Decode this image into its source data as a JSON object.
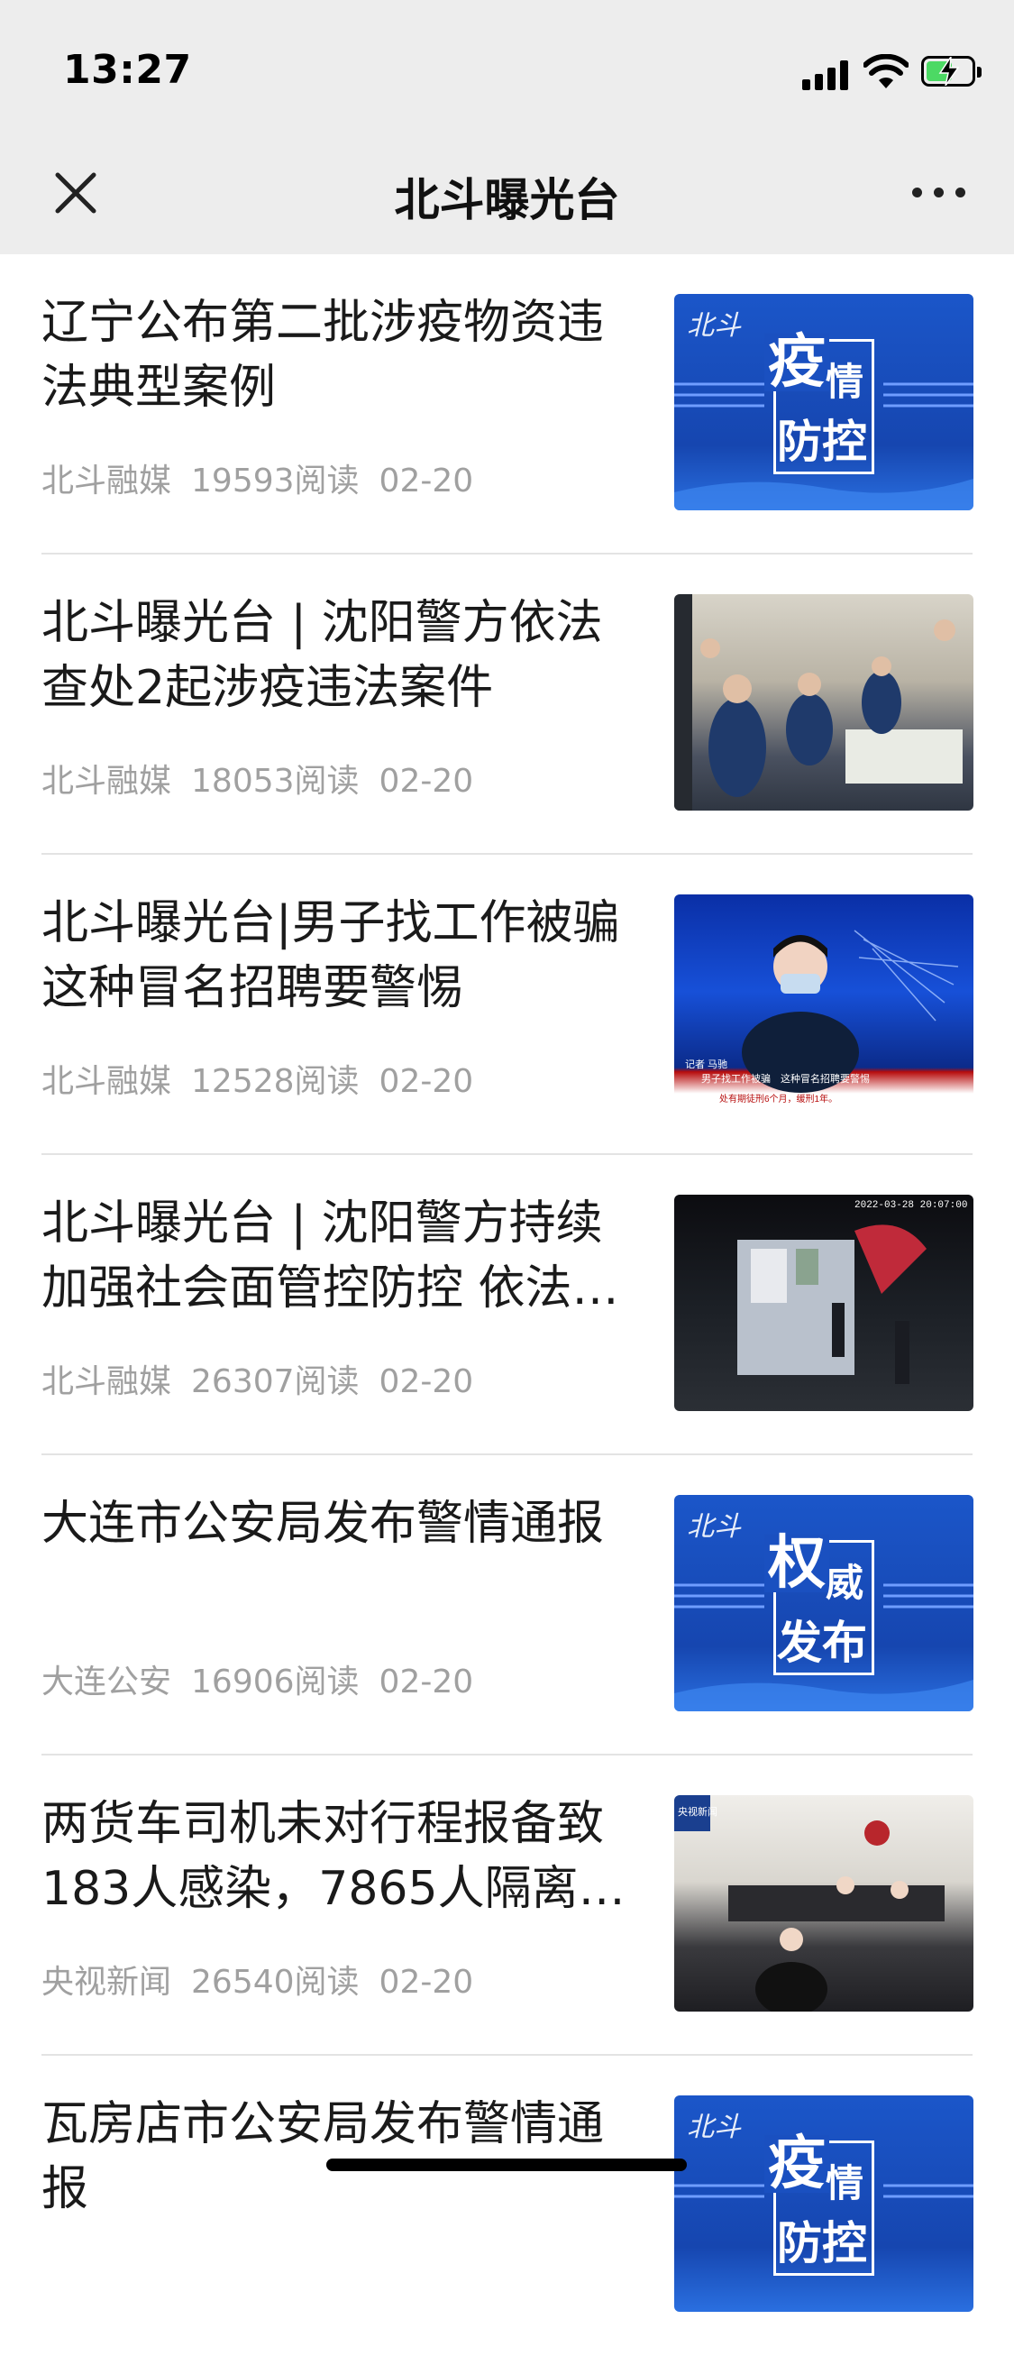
{
  "status_bar": {
    "time": "13:27"
  },
  "nav": {
    "title": "北斗曝光台"
  },
  "articles": [
    {
      "title": "辽宁公布第二批涉疫物资违法典型案例",
      "source": "北斗融媒",
      "reads": "19593阅读",
      "date": "02-20",
      "thumb": {
        "type": "brand-card",
        "brand": "北斗",
        "big": "疫",
        "small": "情",
        "row2": "防控"
      }
    },
    {
      "title": "北斗曝光台 | 沈阳警方依法查处2起涉疫违法案件",
      "source": "北斗融媒",
      "reads": "18053阅读",
      "date": "02-20",
      "thumb": {
        "type": "photo",
        "desc": "room"
      }
    },
    {
      "title": "北斗曝光台|男子找工作被骗这种冒名招聘要警惕",
      "source": "北斗融媒",
      "reads": "12528阅读",
      "date": "02-20",
      "thumb": {
        "type": "photo",
        "desc": "news",
        "caption1": "记者 马驰",
        "caption2": "男子找工作被骗　这种冒名招聘要警惕",
        "caption3": "处有期徒刑6个月，缓刑1年。"
      }
    },
    {
      "title": "北斗曝光台 | 沈阳警方持续加强社会面管控防控 依法查…",
      "source": "北斗融媒",
      "reads": "26307阅读",
      "date": "02-20",
      "thumb": {
        "type": "photo",
        "desc": "night",
        "timestamp": "2022-03-28 20:07:00"
      }
    },
    {
      "title": "大连市公安局发布警情通报",
      "source": "大连公安",
      "reads": "16906阅读",
      "date": "02-20",
      "thumb": {
        "type": "brand-card",
        "brand": "北斗",
        "big": "权",
        "small": "威",
        "row2": "发布"
      }
    },
    {
      "title": "两货车司机未对行程报备致183人感染，7865人隔离…",
      "source": "央视新闻",
      "reads": "26540阅读",
      "date": "02-20",
      "thumb": {
        "type": "photo",
        "desc": "court",
        "logo": "央视新闻"
      }
    },
    {
      "title": "瓦房店市公安局发布警情通报",
      "source": "",
      "reads": "",
      "date": "",
      "thumb": {
        "type": "brand-card",
        "brand": "北斗",
        "big": "疫",
        "small": "情",
        "row2": "防控"
      }
    }
  ]
}
